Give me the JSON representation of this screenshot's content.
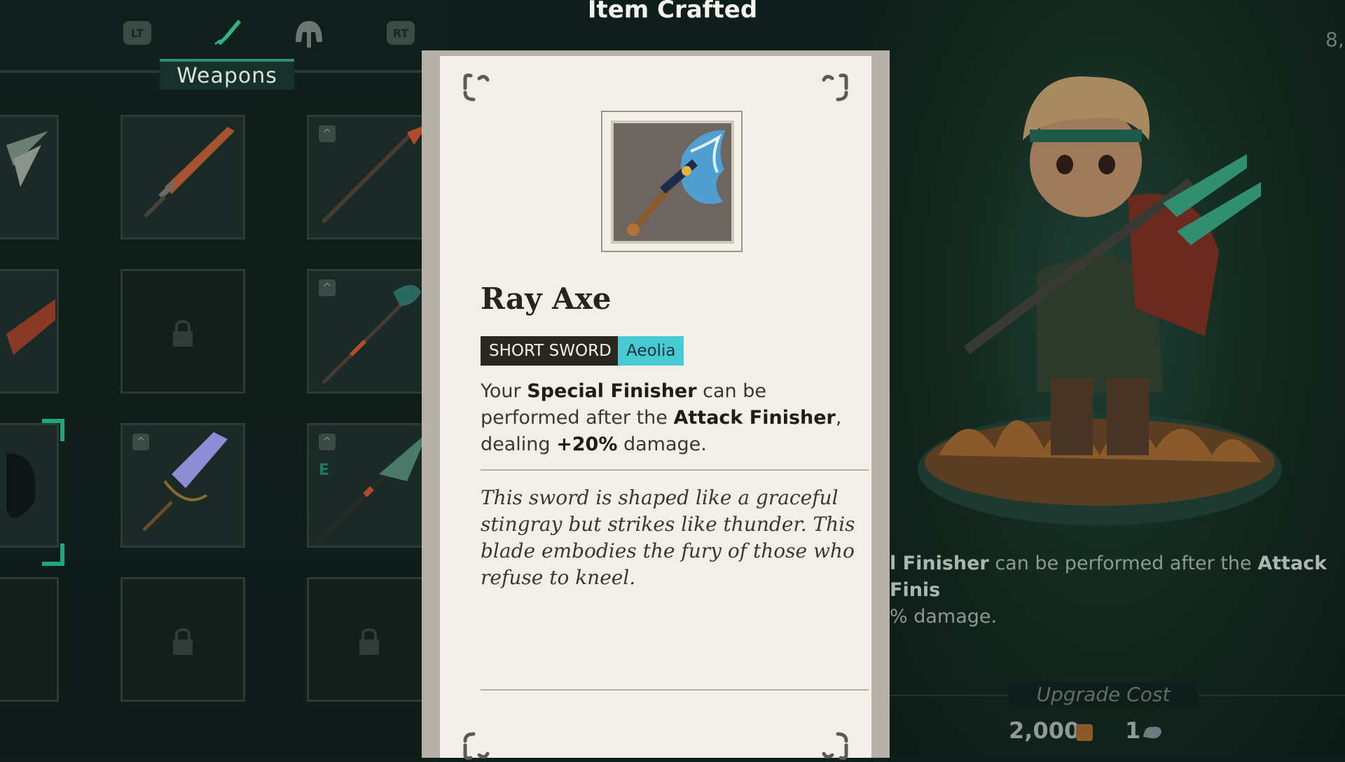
{
  "header": {
    "title": "Item Crafted",
    "left_button": "LT",
    "right_button": "RT",
    "active_tab_label": "Weapons",
    "counter": "8,"
  },
  "item": {
    "name": "Ray Axe",
    "type_tag": "SHORT SWORD",
    "element_tag": "Aeolia",
    "desc_1": "Your ",
    "desc_bold_1": "Special Finisher",
    "desc_2": " can be performed after the ",
    "desc_bold_2": "Attack Finisher",
    "desc_3": ", dealing ",
    "desc_bold_3": "+20%",
    "desc_4": " damage.",
    "lore": "This sword is shaped like a graceful stingray but strikes like thunder. This blade embodies the fury of those who refuse to kneel."
  },
  "preview": {
    "text_bold_1": "l Finisher",
    "text_1": " can be performed after the ",
    "text_bold_2": "Attack Finis",
    "text_2": "% damage.",
    "upgrade_label": "Upgrade Cost",
    "cost_gold": "2,000",
    "cost_material": "1"
  },
  "colors": {
    "accent": "#21a57a",
    "element_badge": "#49c9d3",
    "card_bg": "#f2efe8"
  }
}
